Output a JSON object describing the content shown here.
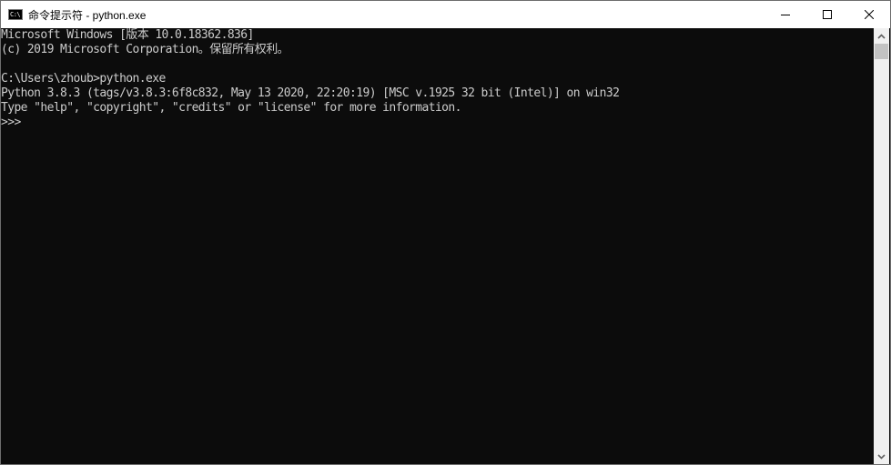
{
  "window": {
    "title": "命令提示符 - python.exe",
    "app_icon": "cmd-icon",
    "app_icon_text": "C:\\",
    "controls": {
      "minimize": "minimize-icon",
      "maximize": "maximize-icon",
      "close": "close-icon"
    }
  },
  "console": {
    "lines": [
      "Microsoft Windows [版本 10.0.18362.836]",
      "(c) 2019 Microsoft Corporation。保留所有权利。",
      "",
      "C:\\Users\\zhoub>python.exe",
      "Python 3.8.3 (tags/v3.8.3:6f8c832, May 13 2020, 22:20:19) [MSC v.1925 32 bit (Intel)] on win32",
      "Type \"help\", \"copyright\", \"credits\" or \"license\" for more information.",
      ">>> "
    ]
  },
  "scrollbar": {
    "up": "chevron-up-icon",
    "down": "chevron-down-icon",
    "position": 0
  }
}
